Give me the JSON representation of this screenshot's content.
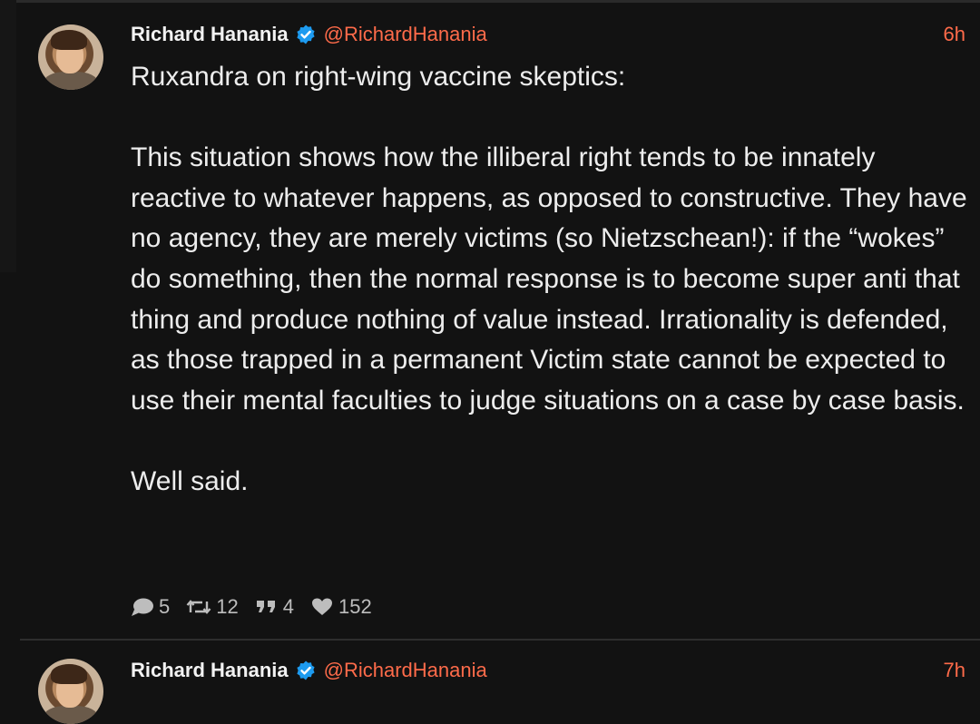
{
  "tweets": [
    {
      "display_name": "Richard Hanania",
      "handle": "@RichardHanania",
      "time": "6h",
      "paragraphs": [
        "Ruxandra on right-wing vaccine skeptics:",
        "This situation shows how the illiberal right tends to be innately reactive to whatever happens, as opposed to constructive. They have no agency, they are merely victims (so Nietzschean!): if the “wokes” do something, then the normal response is to become super anti that thing and produce nothing of value instead. Irrationality is defended, as those trapped in a permanent Victim state cannot be expected to use their mental faculties to judge situations on a case by case basis.",
        "Well said."
      ],
      "stats": {
        "replies": "5",
        "reposts": "12",
        "quotes": "4",
        "likes": "152"
      },
      "icons": {
        "reply": "speech-bubble-icon",
        "repost": "repost-icon",
        "quote": "quote-icon",
        "like": "heart-icon",
        "verified": "verified-badge-icon"
      }
    },
    {
      "display_name": "Richard Hanania",
      "handle": "@RichardHanania",
      "time": "7h"
    }
  ],
  "colors": {
    "background": "#121212",
    "accent": "#ff6b4a",
    "verified": "#1d9bf0"
  }
}
